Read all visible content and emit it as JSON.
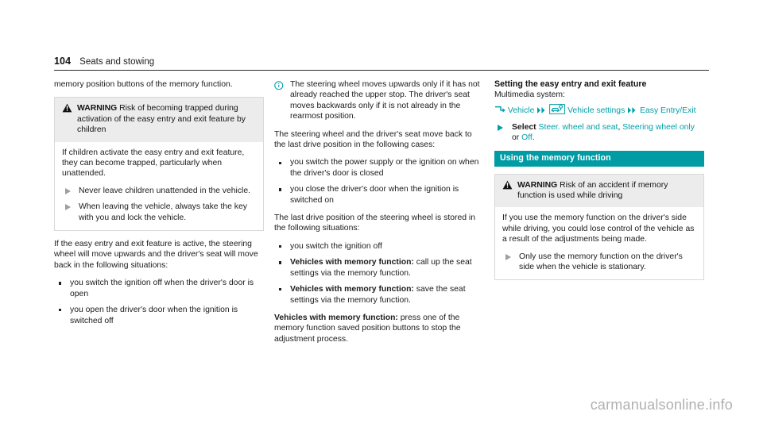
{
  "header": {
    "page_number": "104",
    "chapter": "Seats and stowing"
  },
  "left_column": {
    "intro": "memory position buttons of the memory function.",
    "warning": {
      "icon": "warning-triangle-icon",
      "label": "WARNING",
      "title": "Risk of becoming trapped during activation of the easy entry and exit feature by children",
      "body": "If children activate the easy entry and exit feature, they can become trapped, particularly when unattended.",
      "actions": [
        "Never leave children unattended in the vehicle.",
        "When leaving the vehicle, always take the key with you and lock the vehicle."
      ]
    },
    "after_warning": "If the easy entry and exit feature is active, the steering wheel will move upwards and the driver's seat will move back in the following situations:",
    "bullets": [
      "you switch the ignition off when the driver's door is open",
      "you open the driver's door when the ignition is switched off"
    ]
  },
  "middle_column": {
    "note": {
      "icon": "info-circle-icon",
      "text": "The steering wheel moves upwards only if it has not already reached the upper stop. The driver's seat moves backwards only if it is not already in the rearmost position."
    },
    "para1": "The steering wheel and the driver's seat move back to the last drive position in the following cases:",
    "bullets1": [
      "you switch the power supply or the ignition on when the driver's door is closed",
      "you close the driver's door when the ignition is switched on"
    ],
    "para2": "The last drive position of the steering wheel is stored in the following situations:",
    "bullets2": [
      {
        "lead": "",
        "text": "you switch the ignition off"
      },
      {
        "lead": "Vehicles with memory function:",
        "text": " call up the seat settings via the memory function."
      },
      {
        "lead": "Vehicles with memory function:",
        "text": " save the seat settings via the memory function."
      }
    ],
    "closing_lead": "Vehicles with memory function:",
    "closing_text": " press one of the memory function saved position buttons to stop the adjustment process."
  },
  "right_column": {
    "subhead": "Setting the easy entry and exit feature",
    "multimedia_label": "Multimedia system:",
    "nav": {
      "icon1": "turn-arrow-icon",
      "item1": "Vehicle",
      "chevron1": "double-chevron-icon",
      "icon2": "vehicle-settings-icon",
      "item2": "Vehicle settings",
      "chevron2": "double-chevron-icon",
      "item3": "Easy Entry/Exit"
    },
    "select_action": {
      "prefix": "Select ",
      "option1": "Steer. wheel and seat",
      "sep1": ", ",
      "option2": "Steering wheel only",
      "sep2": " or ",
      "option3": "Off",
      "suffix": "."
    },
    "section_title": "Using the memory function",
    "warning": {
      "icon": "warning-triangle-icon",
      "label": "WARNING",
      "title": "Risk of an accident if memory function is used while driving",
      "body": "If you use the memory function on the driver's side while driving, you could lose control of the vehicle as a result of the adjustments being made.",
      "actions": [
        "Only use the memory function on the driver's side when the vehicle is stationary."
      ]
    }
  },
  "watermark": "carmanualsonline.info",
  "colors": {
    "teal": "#00a0a8",
    "section_bar": "#009ba3",
    "warn_header_bg": "#ececec",
    "watermark": "#b0b0b0"
  }
}
